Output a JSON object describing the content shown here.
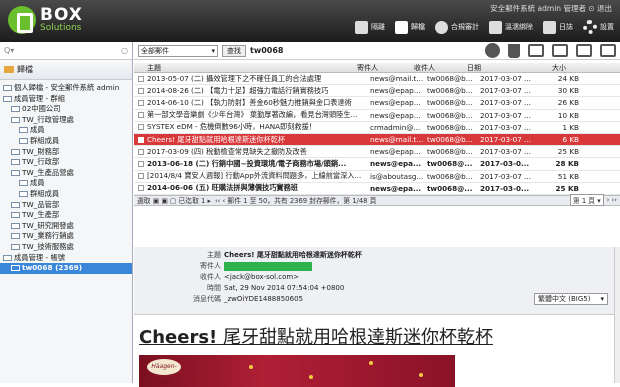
{
  "app": {
    "brand": "BOX",
    "brand_sub": "Solutions",
    "user_line": "安全郵件系統 admin 管理者 ⊙ 退出"
  },
  "tools": [
    {
      "label": "隔離",
      "icon": "quarantine-icon"
    },
    {
      "label": "歸檔",
      "icon": "archive-icon"
    },
    {
      "label": "合規審計",
      "icon": "filter-icon"
    },
    {
      "label": "溫濡綁除",
      "icon": "check-icon"
    },
    {
      "label": "日誌",
      "icon": "log-icon"
    },
    {
      "label": "設置",
      "icon": "gear-icon"
    }
  ],
  "sidebar": {
    "search_placeholder": "Q▾",
    "header": "歸檔",
    "items": [
      {
        "label": "個人歸檔 - 安全郵件系統 admin",
        "indent": 0,
        "type": "person"
      },
      {
        "label": "成員管理 - 群組",
        "indent": 0,
        "type": "group"
      },
      {
        "label": "02中國公司",
        "indent": 1,
        "type": "folder"
      },
      {
        "label": "TW_行政管理處",
        "indent": 1,
        "type": "folder"
      },
      {
        "label": "成員",
        "indent": 2,
        "type": "folder"
      },
      {
        "label": "群組成員",
        "indent": 2,
        "type": "folder"
      },
      {
        "label": "TW_財務部",
        "indent": 1,
        "type": "folder"
      },
      {
        "label": "TW_行政部",
        "indent": 1,
        "type": "folder"
      },
      {
        "label": "TW_生產品營處",
        "indent": 1,
        "type": "folder"
      },
      {
        "label": "成員",
        "indent": 2,
        "type": "folder"
      },
      {
        "label": "群組成員",
        "indent": 2,
        "type": "folder"
      },
      {
        "label": "TW_品管部",
        "indent": 1,
        "type": "folder"
      },
      {
        "label": "TW_生產部",
        "indent": 1,
        "type": "folder"
      },
      {
        "label": "TW_研究開發處",
        "indent": 1,
        "type": "folder"
      },
      {
        "label": "TW_業務行銷處",
        "indent": 1,
        "type": "folder"
      },
      {
        "label": "TW_技術服務處",
        "indent": 1,
        "type": "folder"
      },
      {
        "label": "成員管理 - 帳號",
        "indent": 0,
        "type": "group"
      },
      {
        "label": "tw0068 (2369)",
        "indent": 1,
        "type": "user",
        "selected": true
      }
    ]
  },
  "toolbar": {
    "scope": "全部郵件",
    "search_button": "查找",
    "search_term": "tw0068"
  },
  "columns": {
    "subject": "主題",
    "sender": "寄件人",
    "recipient": "收件人",
    "date": "日期",
    "size": "大小"
  },
  "rows": [
    {
      "subject": "2013-05-07 (二) 攝效管理下之不確任員工的合法處理",
      "sender": "news@mail.t...",
      "recipient": "tw0068@b...",
      "date": "2017-03-07 ...",
      "size": "24 KB",
      "state": ""
    },
    {
      "subject": "2014-08-26 (二) 【電力十足】超強力電話行銷實務技巧",
      "sender": "news@epap...",
      "recipient": "tw0068@b...",
      "date": "2017-03-07 ...",
      "size": "30 KB",
      "state": ""
    },
    {
      "subject": "2014-06-10 (二) 【執力防射】善金60秒魅力推銷與金口表達術",
      "sender": "news@epap...",
      "recipient": "tw0068@b...",
      "date": "2017-03-07 ...",
      "size": "26 KB",
      "state": ""
    },
    {
      "subject": "第一部文學音樂劇《少年台灣》 葉勤厚著改編，看見台灣頭陸生...",
      "sender": "news@epap...",
      "recipient": "tw0068@b...",
      "date": "2017-03-07 ...",
      "size": "10 KB",
      "state": ""
    },
    {
      "subject": "SYSTEX eDM - 危機倒數96小時，HANA即刻救援！",
      "sender": "crmadmin@...",
      "recipient": "tw0068@b...",
      "date": "2017-03-07 ...",
      "size": "1 KB",
      "state": ""
    },
    {
      "subject": "Cheers! 尾牙甜點就用哈根達斯迷你杯乾杯",
      "sender": "news@mail.t...",
      "recipient": "tw0068@b...",
      "date": "2017-03-07 ...",
      "size": "6 KB",
      "state": "sel"
    },
    {
      "subject": "2017-03-09 (四) 稅動檢查常見缺失之撤防及改善",
      "sender": "news@epap...",
      "recipient": "tw0068@b...",
      "date": "2017-03-07 ...",
      "size": "25 KB",
      "state": ""
    },
    {
      "subject": "2013-06-18 (二) 行銷中國~投資環境/電子商務市場/頭銷...",
      "sender": "news@epa...",
      "recipient": "tw0068@...",
      "date": "2017-03-0...",
      "size": "28 KB",
      "state": "bold"
    },
    {
      "subject": "[2014/8/4 寶安人週報] 行動App外流資料問題多，上線前當深入...",
      "sender": "is@aboutasg...",
      "recipient": "tw0068@b...",
      "date": "2017-03-07 ...",
      "size": "51 KB",
      "state": ""
    },
    {
      "subject": "2014-06-06 (五) 旺購法拼與薄價技巧實務班",
      "sender": "news@epa...",
      "recipient": "tw0068@...",
      "date": "2017-03-0...",
      "size": "25 KB",
      "state": "bold"
    }
  ],
  "pager": {
    "left": "選取 ▣ ▣ ▢ 已迄取 1 ▸",
    "info": "‹‹ ‹ 郵件 1 至 50，共有 2369 封存郵件，第 1/48 頁",
    "page": "第 1 頁 ▾",
    "nav": "› ››"
  },
  "preview": {
    "labels": {
      "subject": "主題",
      "from": "寄件人",
      "to": "收件人",
      "time": "時間",
      "msgid": "消息代碼"
    },
    "subject": "Cheers! 尾牙甜點就用哈根達斯迷你杯乾杯",
    "to": "<jack@box-sol.com>",
    "time": "Sat, 29 Nov 2014 07:54:04 +0800",
    "msgid": "_zwOiYDE1488850605",
    "encoding": "繁體中文 (BIG5)",
    "title_en": "Cheers!",
    "title_zh": " 尾牙甜點就用哈根達斯迷你杯乾杯",
    "banner_logo": "Häagen-Dazs"
  }
}
